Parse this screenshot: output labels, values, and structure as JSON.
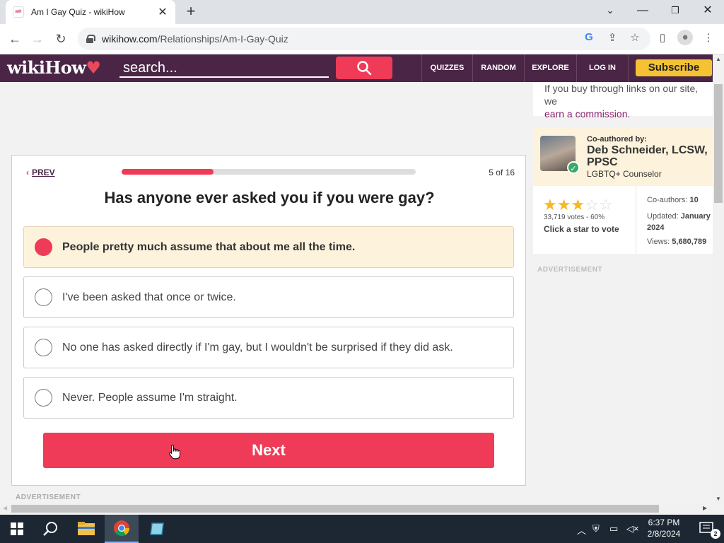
{
  "browser": {
    "tab_title": "Am I Gay Quiz - wikiHow",
    "favicon_text": "wH",
    "url_domain": "wikihow.com",
    "url_path": "/Relationships/Am-I-Gay-Quiz"
  },
  "site_header": {
    "logo_text": "wikiHow",
    "search_placeholder": "search...",
    "nav": [
      "QUIZZES",
      "RANDOM",
      "EXPLORE",
      "LOG IN"
    ],
    "subscribe_label": "Subscribe"
  },
  "quiz": {
    "prev_label": "PREV",
    "progress_text": "5 of 16",
    "progress_fraction": 0.3125,
    "question": "Has anyone ever asked you if you were gay?",
    "options": [
      {
        "text": "People pretty much assume that about me all the time.",
        "selected": true
      },
      {
        "text": "I've been asked that once or twice.",
        "selected": false
      },
      {
        "text": "No one has asked directly if I'm gay, but I wouldn't be surprised if they did ask.",
        "selected": false
      },
      {
        "text": "Never. People assume I'm straight.",
        "selected": false
      }
    ],
    "next_label": "Next"
  },
  "ads": {
    "label": "ADVERTISEMENT"
  },
  "sidebar": {
    "disclosure_line1": "If you buy through links on our site, we",
    "disclosure_link": "earn a commission.",
    "coauthor_label": "Co-authored by:",
    "coauthor_name": "Deb Schneider, LCSW, PPSC",
    "coauthor_role": "LGBTQ+ Counselor",
    "rating_stars": 3,
    "rating_max": 5,
    "votes_text": "33,719 votes - 60%",
    "click_star": "Click a star to vote",
    "coauthors_label": "Co-authors:",
    "coauthors_value": "10",
    "updated_label": "Updated:",
    "updated_value": "January 2024",
    "views_label": "Views:",
    "views_value": "5,680,789"
  },
  "taskbar": {
    "time": "6:37 PM",
    "date": "2/8/2024",
    "notification_count": "2"
  },
  "colors": {
    "brand_purple": "#4a2545",
    "accent_red": "#ef3b58",
    "subscribe_yellow": "#f5c233",
    "selected_bg": "#fdf3dc"
  }
}
